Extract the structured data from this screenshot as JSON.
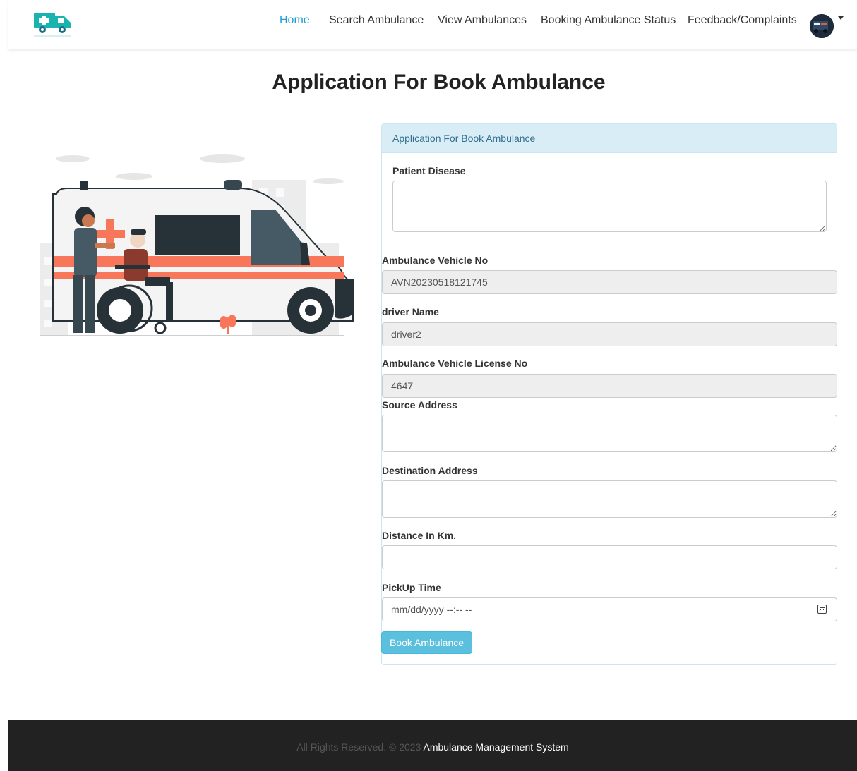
{
  "nav": {
    "logo_icon": "ambulance-logo-icon",
    "accent": "#1e9bd7",
    "links": [
      {
        "label": "Home",
        "active": true
      },
      {
        "label": "Search Ambulance",
        "active": false
      },
      {
        "label": "View Ambulances",
        "active": false
      },
      {
        "label": "Booking Ambulance Status",
        "active": false
      },
      {
        "label": "Feedback/Complaints",
        "active": false
      }
    ],
    "avatar_icon": "user-avatar-icon"
  },
  "page": {
    "title": "Application For Book Ambulance",
    "illustration_icon": "ambulance-illustration"
  },
  "form": {
    "header": "Application For Book Ambulance",
    "header_bg": "#d9edf7",
    "patient_disease_label": "Patient Disease",
    "patient_disease_value": "",
    "vehicle_no_label": "Ambulance Vehicle No",
    "vehicle_no_value": "AVN20230518121745",
    "driver_name_label": "driver Name",
    "driver_name_value": "driver2",
    "license_no_label": "Ambulance Vehicle License No",
    "license_no_value": "4647",
    "source_address_label": "Source Address",
    "source_address_value": "",
    "destination_address_label": "Destination Address",
    "destination_address_value": "",
    "distance_label": "Distance In Km.",
    "distance_value": "",
    "pickup_time_label": "PickUp Time",
    "pickup_time_placeholder": "mm/dd/yyyy --:-- --",
    "submit_label": "Book Ambulance",
    "submit_color": "#5bc0de"
  },
  "footer": {
    "rights": "All Rights Reserved. © 2023",
    "brand": "Ambulance Management System"
  }
}
